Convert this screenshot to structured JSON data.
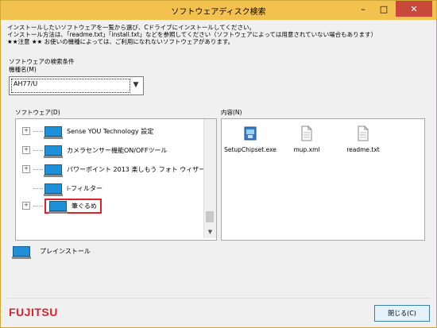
{
  "window": {
    "title": "ソフトウェアディスク検索",
    "min": "–",
    "max": "□",
    "close": "✕"
  },
  "instructions": [
    "インストールしたいソフトウェアを一覧から選び、Cドライブにインストールしてください。",
    "インストール方法は、「readme.txt」「install.txt」などを参照してください（ソフトウェアによっては用意されていない場合もあります）",
    "★★注意 ★★ お使いの機種によっては、ご利用になれないソフトウェアがあります。"
  ],
  "search": {
    "heading": "ソフトウェアの検索条件",
    "model_label": "機種名(M)",
    "model_value": "AH77/U"
  },
  "software": {
    "label": "ソフトウェア(D)",
    "items": [
      {
        "label": "Sense YOU Technology 設定"
      },
      {
        "label": "カメラセンサー機能ON/OFFツール"
      },
      {
        "label": "パワーポイント 2013 楽しもう フォト ウィザード"
      },
      {
        "label": "i-フィルター"
      },
      {
        "label": "筆ぐるめ"
      }
    ]
  },
  "contents": {
    "label": "内容(N)",
    "files": [
      {
        "name": "SetupChipset.exe",
        "icon": "setup-exe-icon"
      },
      {
        "name": "mup.xml",
        "icon": "document-icon"
      },
      {
        "name": "readme.txt",
        "icon": "document-icon"
      }
    ]
  },
  "install_label": "プレインストール",
  "brand": "FUJITSU",
  "close_button": "閉じる(C)"
}
